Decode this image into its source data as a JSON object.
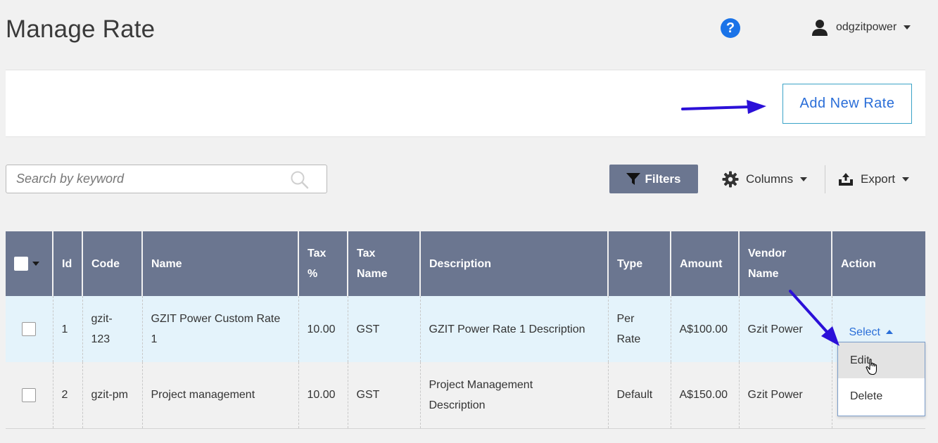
{
  "header": {
    "page_title": "Manage Rate",
    "help_glyph": "?",
    "username": "odgzitpower"
  },
  "action_bar": {
    "add_button_label": "Add New Rate"
  },
  "toolbar": {
    "search_placeholder": "Search by keyword",
    "filters_label": "Filters",
    "columns_label": "Columns",
    "export_label": "Export"
  },
  "table": {
    "headers": {
      "id": "Id",
      "code": "Code",
      "name": "Name",
      "tax_pct_1": "Tax",
      "tax_pct_2": "%",
      "tax_name_1": "Tax",
      "tax_name_2": "Name",
      "description": "Description",
      "type": "Type",
      "amount": "Amount",
      "vendor_1": "Vendor",
      "vendor_2": "Name",
      "action": "Action"
    },
    "rows": [
      {
        "id": "1",
        "code_1": "gzit-",
        "code_2": "123",
        "name_1": "GZIT Power Custom Rate",
        "name_2": "1",
        "tax_pct": "10.00",
        "tax_name": "GST",
        "description_1": "GZIT Power Rate 1 Description",
        "description_2": "",
        "type_1": "Per",
        "type_2": "Rate",
        "amount": "A$100.00",
        "vendor": "Gzit Power",
        "action": "Select"
      },
      {
        "id": "2",
        "code_1": "gzit-pm",
        "code_2": "",
        "name_1": "Project management",
        "name_2": "",
        "tax_pct": "10.00",
        "tax_name": "GST",
        "description_1": "Project Management",
        "description_2": "Description",
        "type_1": "Default",
        "type_2": "",
        "amount": "A$150.00",
        "vendor": "Gzit Power",
        "action": ""
      }
    ]
  },
  "action_menu": {
    "items": [
      "Edit",
      "Delete"
    ]
  },
  "colors": {
    "header_bg": "#6b7690",
    "accent_blue": "#2a6ed8",
    "selected_row": "#e4f3fb",
    "annotation_arrow": "#2b10d8"
  }
}
